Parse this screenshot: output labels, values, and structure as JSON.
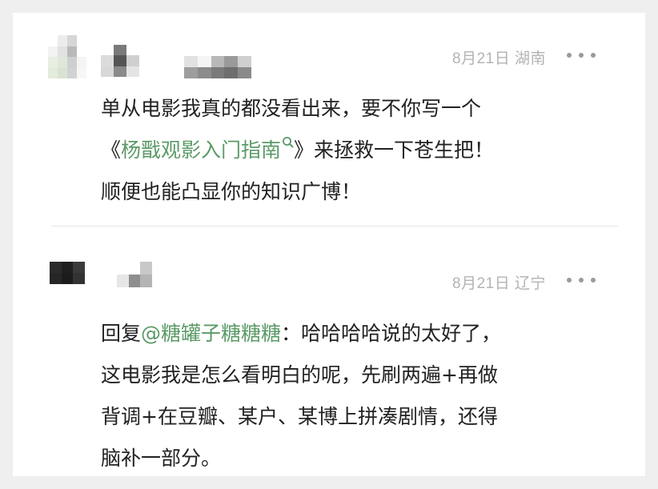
{
  "comments": [
    {
      "meta": "8月21日 湖南",
      "more_icon": "more-dots-icon",
      "lines": {
        "l1": "单从电影我真的都没看出来，要不你写一个",
        "l2_pre": "《",
        "l2_link": "杨戬观影入门指南",
        "l2_post": "》来拯救一下苍生把！",
        "l3": "顺便也能凸显你的知识广博！"
      },
      "link_icon": "search-icon"
    },
    {
      "meta": "8月21日 辽宁",
      "more_icon": "more-dots-icon",
      "lines": {
        "l1_pre": "回复",
        "l1_mention": "@糖罐子糖糖糖",
        "l1_post": "：哈哈哈哈说的太好了，",
        "l2": "这电影我是怎么看明白的呢，先刷两遍+再做",
        "l3": "背调+在豆瓣、某户、某博上拼凑剧情，还得",
        "l4": "脑补一部分。"
      }
    }
  ],
  "colors": {
    "link": "#5b9a67",
    "text": "#222222",
    "meta": "#b3b3b3",
    "background": "#efefef",
    "card": "#ffffff"
  }
}
